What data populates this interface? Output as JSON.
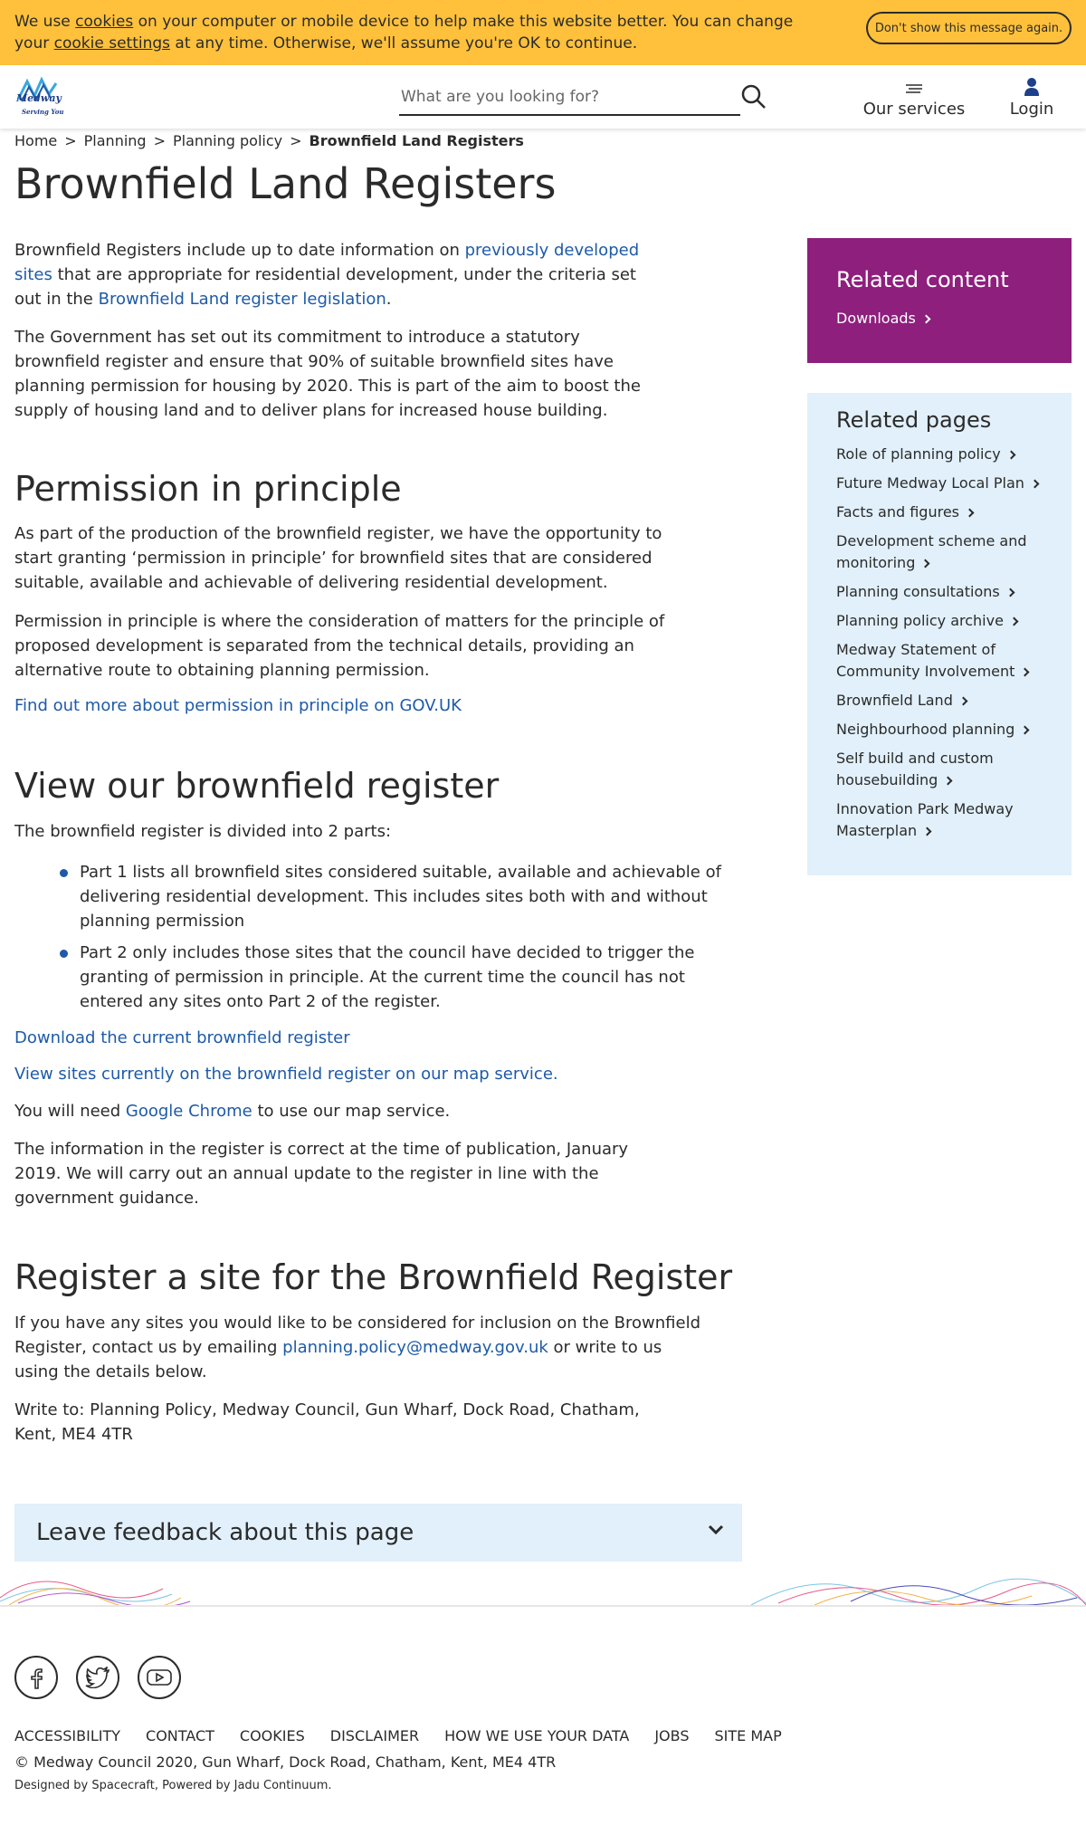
{
  "colors": {
    "cookie_bar": "#ffc13b",
    "link": "#1e5aa8",
    "related_content_bg": "#8e1f7d",
    "related_pages_bg": "#e1f0fa"
  },
  "cookie": {
    "t1": "We use ",
    "cookies_link": "cookies",
    "t2": " on your computer or mobile device to help make this website better. You can change your ",
    "settings_link": "cookie settings",
    "t3": " at any time. Otherwise, we'll assume you're OK to continue.",
    "dismiss": "Don't show this message again."
  },
  "header": {
    "logo_text": "Medway",
    "logo_tagline": "Serving You",
    "search_placeholder": "What are you looking for?",
    "services": "Our services",
    "login": "Login"
  },
  "breadcrumb": [
    "Home",
    "Planning",
    "Planning policy",
    "Brownfield Land Registers"
  ],
  "page_title": "Brownfield Land Registers",
  "intro": {
    "p1_a": "Brownfield Registers include up to date information on ",
    "p1_link1": "previously developed sites",
    "p1_b": " that are appropriate for residential development, under the criteria set out in the ",
    "p1_link2": "Brownfield Land register legislation",
    "p1_c": ".",
    "p2": "The Government has set out its commitment to introduce a statutory brownfield register and ensure that 90% of suitable brownfield sites have planning permission for housing by 2020. This is part of the aim to boost the supply of housing land and to deliver plans for increased house building."
  },
  "pip": {
    "heading": "Permission in principle",
    "p1": "As part of the production of the brownfield register, we have the opportunity to start granting ‘permission in principle’ for brownfield sites that are considered suitable, available and achievable of delivering residential development.",
    "p2": "Permission in principle is where the consideration of matters for the principle of proposed development is separated from the technical details, providing an alternative route to obtaining planning permission.",
    "link": "Find out more about permission in principle on GOV.UK"
  },
  "view": {
    "heading": "View our brownfield register",
    "intro": "The brownfield register is divided into 2 parts:",
    "parts": [
      "Part 1 lists all brownfield sites considered suitable, available and achievable of delivering residential development. This includes sites both with and without planning permission",
      "Part 2 only includes those sites that the council have decided to trigger the granting of permission in principle. At the current time the council has not entered any sites onto Part 2 of the register."
    ],
    "download_link": "Download the current brownfield register",
    "map_link": "View sites currently on the brownfield register on our map service.",
    "chrome_a": "You will need ",
    "chrome_link": "Google Chrome",
    "chrome_b": " to use our map service.",
    "info": "The information in the register is correct at the time of publication, January 2019. We will carry out an annual update to the register in line with the government guidance."
  },
  "register": {
    "heading": "Register a site for the Brownfield Register",
    "p1_a": "If you have any sites you would like to be considered for inclusion on the Brownfield Register, contact us by emailing ",
    "email": "planning.policy@medway.gov.uk",
    "p1_b": " or write to us using the details below.",
    "p2": "Write to: Planning Policy, Medway Council, Gun Wharf, Dock Road, Chatham, Kent, ME4 4TR"
  },
  "sidebar": {
    "related_content_title": "Related content",
    "downloads": "Downloads",
    "related_pages_title": "Related pages",
    "pages": [
      "Role of planning policy",
      "Future Medway Local Plan",
      "Facts and figures",
      "Development scheme and monitoring",
      "Planning consultations",
      "Planning policy archive",
      "Medway Statement of Community Involvement",
      "Brownfield Land",
      "Neighbourhood planning",
      "Self build and custom housebuilding",
      "Innovation Park Medway Masterplan"
    ]
  },
  "feedback": "Leave feedback about this page",
  "footer": {
    "links": [
      "ACCESSIBILITY",
      "CONTACT",
      "COOKIES",
      "DISCLAIMER",
      "HOW WE USE YOUR DATA",
      "JOBS",
      "SITE MAP"
    ],
    "copyright": "© Medway Council 2020, Gun Wharf, Dock Road, Chatham, Kent, ME4 4TR",
    "designed": "Designed by Spacecraft, Powered by Jadu Continuum."
  }
}
